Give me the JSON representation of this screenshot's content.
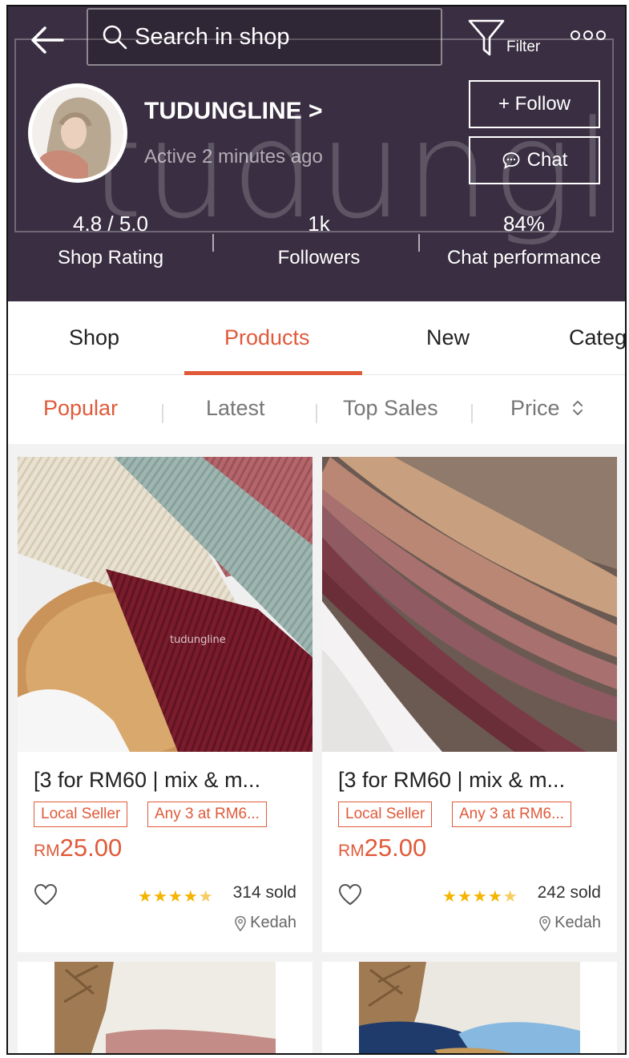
{
  "header": {
    "search_placeholder": "Search in shop",
    "filter_label": "Filter",
    "watermark": "tudungline"
  },
  "shop": {
    "name": "TUDUNGLINE >",
    "active": "Active 2 minutes ago",
    "follow_label": "+ Follow",
    "chat_label": "Chat"
  },
  "stats": [
    {
      "value": "4.8 / 5.0",
      "label": "Shop Rating"
    },
    {
      "value": "1k",
      "label": "Followers"
    },
    {
      "value": "84%",
      "label": "Chat performance"
    }
  ],
  "tabs": [
    "Shop",
    "Products",
    "New",
    "Categ"
  ],
  "active_tab": "Products",
  "sorts": [
    "Popular",
    "Latest",
    "Top Sales",
    "Price"
  ],
  "active_sort": "Popular",
  "products": [
    {
      "title": "[3 for RM60 | mix & m...",
      "tags": [
        "Local Seller",
        "Any 3 at RM6..."
      ],
      "price_currency": "RM",
      "price_amount": "25.00",
      "rating": 4.5,
      "sold": "314 sold",
      "location": "Kedah",
      "image_watermark": "tudungline"
    },
    {
      "title": "[3 for RM60 | mix & m...",
      "tags": [
        "Local Seller",
        "Any 3 at RM6..."
      ],
      "price_currency": "RM",
      "price_amount": "25.00",
      "rating": 4.5,
      "sold": "242 sold",
      "location": "Kedah"
    }
  ],
  "colors": {
    "header_bg": "#3a2f42",
    "accent": "#e05a3a",
    "star": "#f5b400"
  },
  "icons": [
    "back-arrow-icon",
    "search-icon",
    "filter-icon",
    "more-icon",
    "chat-bubble-icon",
    "heart-icon",
    "star-icon",
    "location-pin-icon",
    "sort-arrows-icon"
  ]
}
